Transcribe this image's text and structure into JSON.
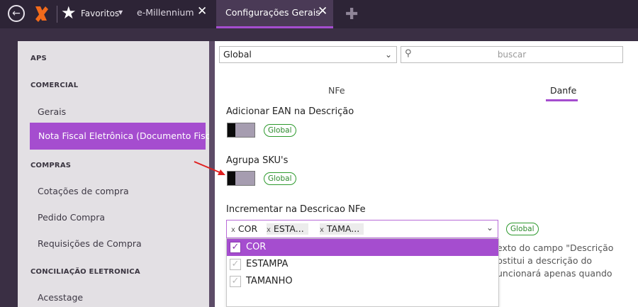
{
  "topbar": {
    "favorites_label": "Favoritos",
    "tabs": [
      {
        "label": "e-Millennium",
        "active": false
      },
      {
        "label": "Configurações Gerais",
        "active": true
      }
    ],
    "close_glyph": "✕",
    "add_glyph": "✚",
    "icons": [
      "back-arrow-icon",
      "logo-icon",
      "star-icon",
      "close-icon",
      "add-icon"
    ]
  },
  "sidebar": {
    "sections": [
      {
        "label": "APS"
      },
      {
        "label": "COMERCIAL",
        "items": [
          "Gerais",
          "Nota Fiscal Eletrônica (Documento Fiscal)"
        ]
      },
      {
        "label": "COMPRAS",
        "items": [
          "Cotações de compra",
          "Pedido Compra",
          "Requisições de Compra"
        ]
      },
      {
        "label": "CONCILIAÇÃO ELETRONICA",
        "items": [
          "Acesstage"
        ]
      }
    ],
    "active_item": "Nota Fiscal Eletrônica (Documento Fiscal)"
  },
  "main": {
    "scope_select": "Global",
    "search_placeholder": "buscar",
    "tabs": [
      {
        "label": "NFe",
        "active": false
      },
      {
        "label": "Danfe",
        "active": true
      }
    ],
    "settings": [
      {
        "label": "Adicionar EAN na Descrição",
        "badge": "Global",
        "toggle_on": false
      },
      {
        "label": "Agrupa SKU's",
        "badge": "Global",
        "toggle_on": false
      }
    ],
    "increment": {
      "label": "Incrementar na Descricao NFe",
      "badge": "Global",
      "chips": [
        "COR",
        "ESTA...",
        "TAMA..."
      ],
      "options": [
        {
          "label": "COR",
          "checked": true,
          "highlighted": true
        },
        {
          "label": "ESTAMPA",
          "checked": true,
          "highlighted": false
        },
        {
          "label": "TAMANHO",
          "checked": true,
          "highlighted": false
        }
      ],
      "description_fragments": [
        "exto do campo \"Descrição",
        "bstitui a descrição do",
        "uncionará apenas quando"
      ]
    }
  },
  "colors": {
    "accent": "#a54dcf",
    "topbar": "#2d2436",
    "sidebar": "#e3e0e4",
    "badge": "#2d9a2d",
    "logo": "#f26a1b"
  }
}
